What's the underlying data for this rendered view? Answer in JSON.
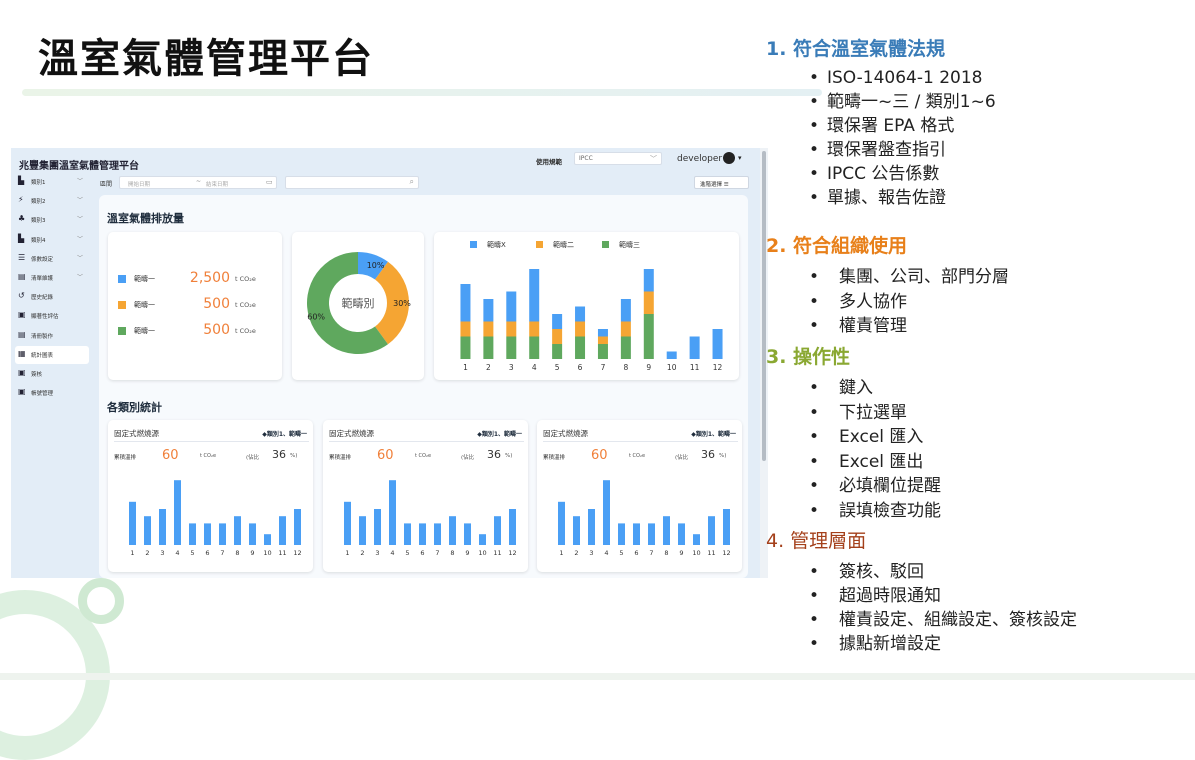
{
  "slide": {
    "title": "溫室氣體管理平台",
    "sections": [
      {
        "number": "1.",
        "title": "1. 符合溫室氣體法規",
        "color": "#3a7cb8",
        "items": [
          "ISO-14064-1 2018",
          "範疇一~三 / 類別1~6",
          "環保署 EPA 格式",
          "環保署盤查指引",
          "IPCC 公告係數",
          "單據、報告佐證"
        ]
      },
      {
        "number": "2.",
        "title": "2. 符合組織使用",
        "color": "#e8801a",
        "items": [
          "集團、公司、部門分層",
          "多人協作",
          "權責管理"
        ]
      },
      {
        "number": "3.",
        "title": "3. 操作性",
        "color": "#8aa832",
        "items": [
          "鍵入",
          "下拉選單",
          "Excel 匯入",
          "Excel 匯出",
          "必填欄位提醒",
          "誤填檢查功能"
        ]
      },
      {
        "number": "4.",
        "title": "4. 管理層面",
        "color": "#a4401b",
        "items": [
          "簽核、駁回",
          "超過時限通知",
          "權責設定、組織設定、簽核設定",
          "據點新增設定"
        ]
      }
    ]
  },
  "app": {
    "title": "兆豐集團溫室氣體管理平台",
    "system_label": "使用規範",
    "system_value": "IPCC",
    "user": "developer",
    "sidebar": [
      {
        "icon": "bar-chart-icon",
        "glyph": "▙",
        "label": "類別1",
        "chevron": "﹀"
      },
      {
        "icon": "lightning-icon",
        "glyph": "⚡",
        "label": "類別2",
        "chevron": "﹀"
      },
      {
        "icon": "network-icon",
        "glyph": "♣",
        "label": "類別3",
        "chevron": "﹀"
      },
      {
        "icon": "bar-chart-icon",
        "glyph": "▙",
        "label": "類別4",
        "chevron": "﹀"
      },
      {
        "icon": "database-icon",
        "glyph": "☰",
        "label": "係數設定",
        "chevron": "﹀"
      },
      {
        "icon": "list-icon",
        "glyph": "▤",
        "label": "清單維護",
        "chevron": "﹀"
      },
      {
        "icon": "history-icon",
        "glyph": "↺",
        "label": "歷史紀錄",
        "chevron": ""
      },
      {
        "icon": "clipboard-icon",
        "glyph": "▣",
        "label": "顯著性評估",
        "chevron": ""
      },
      {
        "icon": "report-icon",
        "glyph": "▤",
        "label": "清冊製作",
        "chevron": ""
      },
      {
        "icon": "stats-icon",
        "glyph": "▦",
        "label": "統計圖表",
        "chevron": "",
        "active": true
      },
      {
        "icon": "approve-icon",
        "glyph": "▣",
        "label": "簽核",
        "chevron": ""
      },
      {
        "icon": "account-icon",
        "glyph": "▣",
        "label": "帳號管理",
        "chevron": ""
      }
    ],
    "filter": {
      "label": "區間",
      "start_placeholder": "開始日期",
      "end_placeholder": "結束日期",
      "advanced_label": "進階選擇 ☰"
    },
    "emissions": {
      "heading": "溫室氣體排放量",
      "rows": [
        {
          "name": "範疇一",
          "value": "2,500",
          "unit": "t CO₂e",
          "color": "#4a9ff5"
        },
        {
          "name": "範疇一",
          "value": "500",
          "unit": "t CO₂e",
          "color": "#f5a533"
        },
        {
          "name": "範疇一",
          "value": "500",
          "unit": "t CO₂e",
          "color": "#5fa85e"
        }
      ]
    },
    "category_heading": "各類別統計",
    "mini_cards": [
      {
        "caption": "固定式燃燒源",
        "tag": "◆類別1、範疇一",
        "kpi_label": "累積溫排",
        "kpi_value": "60",
        "kpi_unit": "t CO₂e",
        "share_label": "(佔比",
        "share_value": "36",
        "share_unit": "%)"
      },
      {
        "caption": "固定式燃燒源",
        "tag": "◆類別1、範疇一",
        "kpi_label": "累積溫排",
        "kpi_value": "60",
        "kpi_unit": "t CO₂e",
        "share_label": "(佔比",
        "share_value": "36",
        "share_unit": "%)"
      },
      {
        "caption": "固定式燃燒源",
        "tag": "◆類別1、範疇一",
        "kpi_label": "累積溫排",
        "kpi_value": "60",
        "kpi_unit": "t CO₂e",
        "share_label": "(佔比",
        "share_value": "36",
        "share_unit": "%)"
      }
    ]
  },
  "chart_data": [
    {
      "type": "pie",
      "title": "範疇別",
      "slices": [
        {
          "label": "範疇X",
          "value": 10,
          "color": "#4a9ff5"
        },
        {
          "label": "範疇二",
          "value": 30,
          "color": "#f5a533"
        },
        {
          "label": "範疇三",
          "value": 60,
          "color": "#5fa85e"
        }
      ],
      "data_labels": [
        "10%",
        "30%",
        "60%"
      ]
    },
    {
      "type": "bar",
      "stacked": true,
      "legend": "top",
      "categories": [
        "1",
        "2",
        "3",
        "4",
        "5",
        "6",
        "7",
        "8",
        "9",
        "10",
        "11",
        "12"
      ],
      "series": [
        {
          "name": "範疇三",
          "color": "#5fa85e",
          "values": [
            3,
            3,
            3,
            3,
            2,
            3,
            2,
            3,
            6,
            0,
            0,
            0
          ]
        },
        {
          "name": "範疇二",
          "color": "#f5a533",
          "values": [
            2,
            2,
            2,
            2,
            2,
            2,
            1,
            2,
            3,
            0,
            0,
            0
          ]
        },
        {
          "name": "範疇X",
          "color": "#4a9ff5",
          "values": [
            5,
            3,
            4,
            7,
            2,
            2,
            1,
            3,
            3,
            1,
            3,
            4
          ]
        }
      ],
      "ylim": [
        0,
        14
      ]
    },
    {
      "type": "bar",
      "categories": [
        "1",
        "2",
        "3",
        "4",
        "5",
        "6",
        "7",
        "8",
        "9",
        "10",
        "11",
        "12"
      ],
      "values": [
        6,
        4,
        5,
        9,
        3,
        3,
        3,
        4,
        3,
        1.5,
        4,
        5
      ],
      "color": "#4a9ff5",
      "ylim": [
        0,
        10
      ]
    },
    {
      "type": "bar",
      "categories": [
        "1",
        "2",
        "3",
        "4",
        "5",
        "6",
        "7",
        "8",
        "9",
        "10",
        "11",
        "12"
      ],
      "values": [
        6,
        4,
        5,
        9,
        3,
        3,
        3,
        4,
        3,
        1.5,
        4,
        5
      ],
      "color": "#4a9ff5",
      "ylim": [
        0,
        10
      ]
    },
    {
      "type": "bar",
      "categories": [
        "1",
        "2",
        "3",
        "4",
        "5",
        "6",
        "7",
        "8",
        "9",
        "10",
        "11",
        "12"
      ],
      "values": [
        6,
        4,
        5,
        9,
        3,
        3,
        3,
        4,
        3,
        1.5,
        4,
        5
      ],
      "color": "#4a9ff5",
      "ylim": [
        0,
        10
      ]
    }
  ]
}
